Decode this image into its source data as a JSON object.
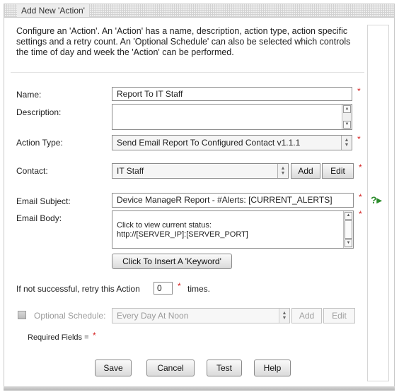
{
  "dialog": {
    "title": "Add New 'Action'",
    "intro": "Configure an 'Action'. An 'Action' has a name, description, action type, action specific settings and a retry count. An 'Optional Schedule' can also be selected which controls the time of day and week the 'Action' can be performed."
  },
  "form": {
    "name_label": "Name:",
    "name_value": "Report To IT Staff",
    "description_label": "Description:",
    "description_value": "",
    "action_type_label": "Action Type:",
    "action_type_value": "Send Email Report To Configured Contact v1.1.1",
    "contact_label": "Contact:",
    "contact_value": "IT Staff",
    "contact_add": "Add",
    "contact_edit": "Edit",
    "email_subject_label": "Email Subject:",
    "email_subject_value": "Device ManageR Report - #Alerts: [CURRENT_ALERTS]",
    "email_body_label": "Email Body:",
    "email_body_line1": "Click to view current status:",
    "email_body_line2": "http://[SERVER_IP]:[SERVER_PORT]",
    "insert_keyword_button": "Click To Insert A 'Keyword'",
    "retry_prefix": "If not successful, retry this Action",
    "retry_value": "0",
    "retry_suffix": "times.",
    "schedule_label": "Optional Schedule:",
    "schedule_value": "Every Day At Noon",
    "schedule_add": "Add",
    "schedule_edit": "Edit",
    "required_text": "Required Fields =",
    "required_mark": "*"
  },
  "buttons": {
    "save": "Save",
    "cancel": "Cancel",
    "test": "Test",
    "help": "Help"
  },
  "icons": {
    "help": "?▸"
  },
  "colors": {
    "required": "#d42020",
    "help_icon": "#2c8c2c"
  }
}
